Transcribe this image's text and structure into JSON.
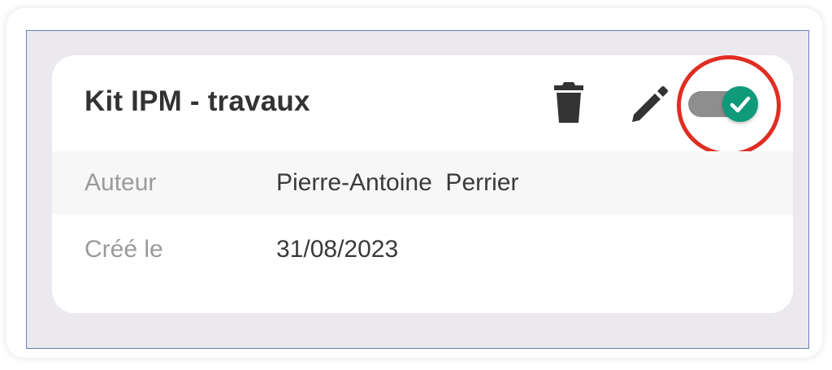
{
  "card": {
    "title": "Kit IPM - travaux",
    "actions": {
      "delete_icon": "trash-icon",
      "edit_icon": "pencil-icon",
      "toggle_state": "on",
      "toggle_icon": "check-icon"
    },
    "fields": [
      {
        "label": "Auteur",
        "value": "Pierre-Antoine  Perrier"
      },
      {
        "label": "Créé le",
        "value": "31/08/2023"
      }
    ]
  },
  "colors": {
    "toggle_on": "#0f9a7a",
    "toggle_track": "#8e8e8e",
    "highlight_ring": "#e02d22",
    "panel_border": "#6a7fb5",
    "panel_bg": "#ebe9ee"
  }
}
